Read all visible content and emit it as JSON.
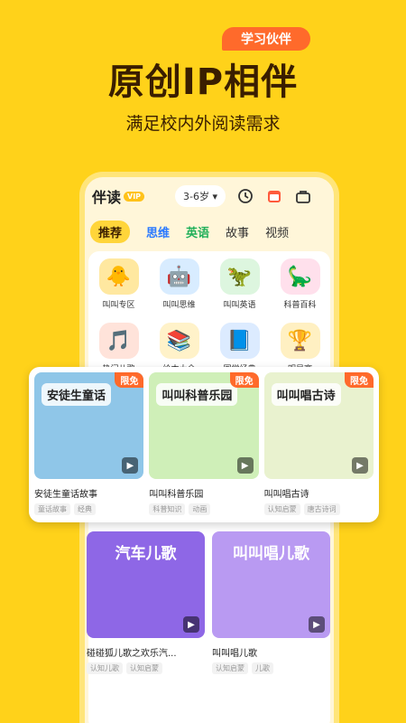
{
  "promo": {
    "badge": "学习伙伴",
    "headline": "原创IP相伴",
    "subline": "满足校内外阅读需求"
  },
  "app": {
    "title": "伴读",
    "vip": "VIP",
    "age": "3-6岁",
    "icons": [
      "clock-icon",
      "calendar-icon",
      "bag-icon"
    ]
  },
  "tabs": [
    {
      "label": "推荐",
      "active": true
    },
    {
      "label": "思维",
      "style": "blue"
    },
    {
      "label": "英语",
      "style": "green"
    },
    {
      "label": "故事"
    },
    {
      "label": "视频"
    }
  ],
  "categories": [
    {
      "label": "叫叫专区",
      "icon": "🐥",
      "color": "#FFE8A0"
    },
    {
      "label": "叫叫思维",
      "icon": "🤖",
      "color": "#D8ECFF"
    },
    {
      "label": "叫叫英语",
      "icon": "🦖",
      "color": "#DDF6DF"
    },
    {
      "label": "科普百科",
      "icon": "🦕",
      "color": "#FFE0EC"
    },
    {
      "label": "热门儿歌",
      "icon": "🎵",
      "color": "#FFE3DA"
    },
    {
      "label": "绘本大全",
      "icon": "📚",
      "color": "#FFF2C9"
    },
    {
      "label": "国学经典",
      "icon": "📘",
      "color": "#DCEBFF"
    },
    {
      "label": "明星赛",
      "icon": "🏆",
      "color": "#FFF0C2"
    }
  ],
  "featured": [
    {
      "title": "安徒生童话故事",
      "thumb_text": "安徒生童话",
      "badge": "限免",
      "tags": [
        "童话故事",
        "经典"
      ],
      "color": "#8FC6E8"
    },
    {
      "title": "叫叫科普乐园",
      "thumb_text": "叫叫科普乐园",
      "badge": "限免",
      "tags": [
        "科普知识",
        "动画"
      ],
      "color": "#CFEFB8"
    },
    {
      "title": "叫叫唱古诗",
      "thumb_text": "叫叫唱古诗",
      "badge": "限免",
      "tags": [
        "认知启蒙",
        "唐古诗词"
      ],
      "color": "#E9F2CF"
    }
  ],
  "lower": [
    {
      "title": "碰碰狐儿歌之欢乐汽...",
      "thumb_text": "汽车儿歌",
      "tags": [
        "认知儿歌",
        "认知启蒙"
      ],
      "color": "#8E67E6"
    },
    {
      "title": "叫叫唱儿歌",
      "thumb_text": "叫叫唱儿歌",
      "tags": [
        "认知启蒙",
        "儿歌"
      ],
      "color": "#B99AF2"
    }
  ]
}
